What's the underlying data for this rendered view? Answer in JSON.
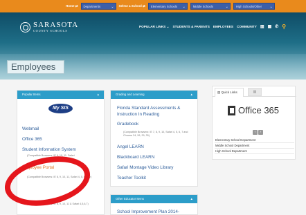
{
  "topbar": {
    "home": "Home ⇄",
    "departments": "Departments",
    "select_school": "Select a School ⇄",
    "elementary": "Elementary Schools",
    "middle": "Middle Schools",
    "high": "High Schools/Other"
  },
  "header": {
    "logo_title": "SARASOTA",
    "logo_sub": "COUNTY SCHOOLS",
    "nav": [
      "POPULAR LINKS ⌄",
      "STUDENTS & PARENTS",
      "EMPLOYEES",
      "COMMUNITY"
    ]
  },
  "page_title": "Employees",
  "popular": {
    "header": "Popular Items",
    "logo": "My SIS",
    "items": [
      "Webmail",
      "Office 365",
      "Student Information System",
      "Employee Portal"
    ],
    "notes": [
      "(Compatible Browsers: IE 9, 10, 11, Safari",
      "(Compatible Browsers: IE 8, 9, 10, 11, Safari 4, 5, 6 only)",
      "(Compatible Browsers: IE 8, 9, 10, 11 & Safari 4,5,6,7)"
    ]
  },
  "grading": {
    "header": "Grading and Learning",
    "links": [
      "Florida Standard Assessments & Instruction In Reading",
      "Gradebook",
      "Angel LEARN",
      "Blackboard LEARN",
      "Safari Montage Video Library",
      "Teacher Toolkit"
    ],
    "gradebook_note": "(Compatible Browsers: IE 7, 8, 9, 10, Safari 4, 5, 6, 7 and Chrome 24, 26, 29, 30)"
  },
  "other": {
    "header": "Other Educator Items",
    "link": "School Improvement Plan 2014-"
  },
  "quick": {
    "tab": "Quick Links",
    "office": "Office 365",
    "depts": [
      "Elementary School Department",
      "Middle School Department",
      "High School Department"
    ]
  }
}
